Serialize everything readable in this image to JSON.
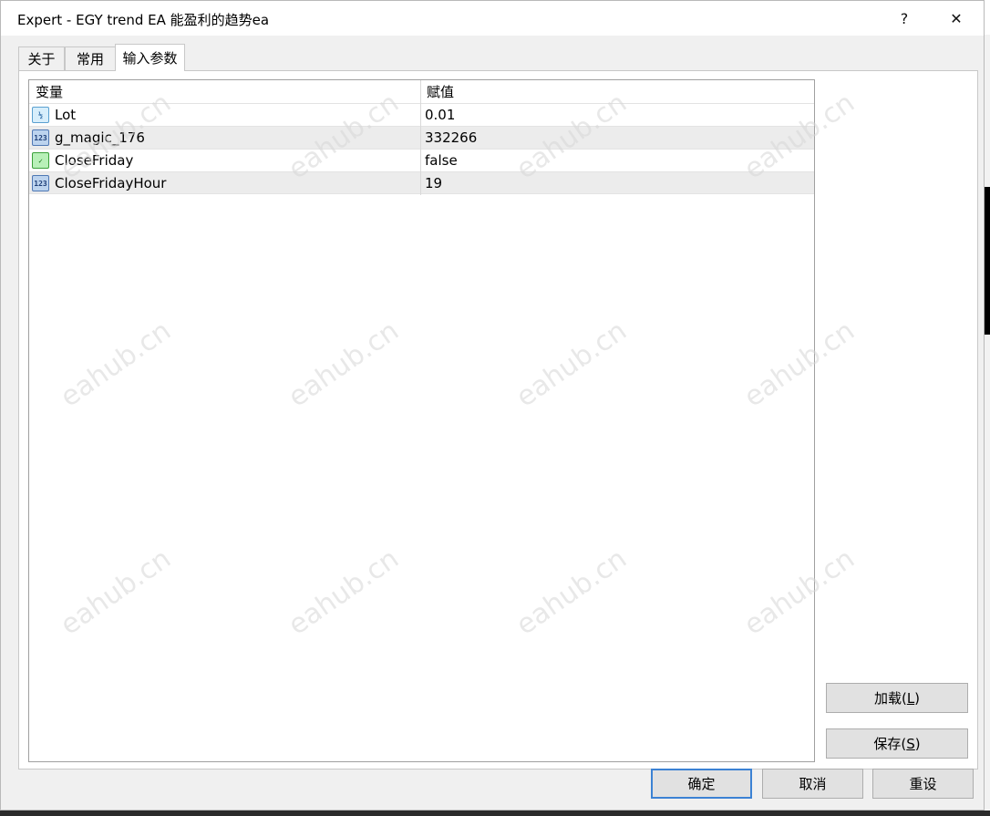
{
  "window": {
    "title": "Expert - EGY trend EA 能盈利的趋势ea",
    "help_glyph": "?",
    "close_glyph": "✕"
  },
  "tabs": [
    {
      "label": "关于",
      "active": false
    },
    {
      "label": "常用",
      "active": false
    },
    {
      "label": "输入参数",
      "active": true
    }
  ],
  "grid": {
    "columns": [
      "变量",
      "赋值"
    ],
    "rows": [
      {
        "icon": "fraction-icon",
        "icon_text": "½",
        "variable": "Lot",
        "value": "0.01"
      },
      {
        "icon": "integer-icon",
        "icon_text": "123",
        "variable": "g_magic_176",
        "value": "332266"
      },
      {
        "icon": "boolean-icon",
        "icon_text": "✓",
        "variable": "CloseFriday",
        "value": "false"
      },
      {
        "icon": "integer-icon",
        "icon_text": "123",
        "variable": "CloseFridayHour",
        "value": "19"
      }
    ]
  },
  "buttons": {
    "load": {
      "main": "加载(",
      "key": "L",
      "end": ")"
    },
    "save": {
      "main": "保存(",
      "key": "S",
      "end": ")"
    },
    "ok": "确定",
    "cancel": "取消",
    "reset": "重设"
  },
  "watermark": "eahub.cn",
  "colors": {
    "default_button_border": "#3c82d4",
    "alt_row": "#ececec",
    "dialog_bg": "#f0f0f0"
  }
}
